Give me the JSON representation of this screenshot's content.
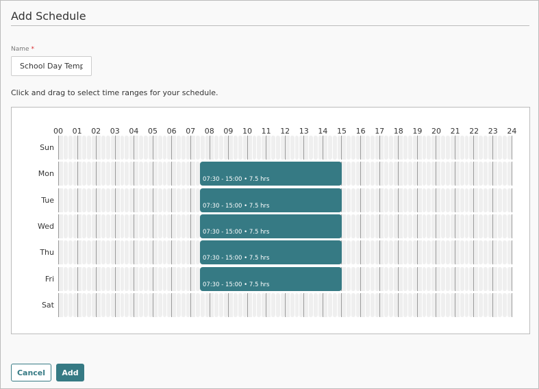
{
  "title": "Add Schedule",
  "name_field": {
    "label": "Name",
    "required_mark": "*",
    "value": "School Day Templ"
  },
  "hint": "Click and drag to select time ranges for your schedule.",
  "hours": [
    "00",
    "01",
    "02",
    "03",
    "04",
    "05",
    "06",
    "07",
    "08",
    "09",
    "10",
    "11",
    "12",
    "13",
    "14",
    "15",
    "16",
    "17",
    "18",
    "19",
    "20",
    "21",
    "22",
    "23",
    "24"
  ],
  "days": [
    {
      "label": "Sun",
      "ranges": []
    },
    {
      "label": "Mon",
      "ranges": [
        {
          "start": 7.5,
          "end": 15,
          "text": "07:30 - 15:00 • 7.5 hrs"
        }
      ]
    },
    {
      "label": "Tue",
      "ranges": [
        {
          "start": 7.5,
          "end": 15,
          "text": "07:30 - 15:00 • 7.5 hrs"
        }
      ]
    },
    {
      "label": "Wed",
      "ranges": [
        {
          "start": 7.5,
          "end": 15,
          "text": "07:30 - 15:00 • 7.5 hrs"
        }
      ]
    },
    {
      "label": "Thu",
      "ranges": [
        {
          "start": 7.5,
          "end": 15,
          "text": "07:30 - 15:00 • 7.5 hrs"
        }
      ]
    },
    {
      "label": "Fri",
      "ranges": [
        {
          "start": 7.5,
          "end": 15,
          "text": "07:30 - 15:00 • 7.5 hrs"
        }
      ]
    },
    {
      "label": "Sat",
      "ranges": []
    }
  ],
  "buttons": {
    "cancel": "Cancel",
    "add": "Add"
  },
  "colors": {
    "accent": "#367a84"
  }
}
